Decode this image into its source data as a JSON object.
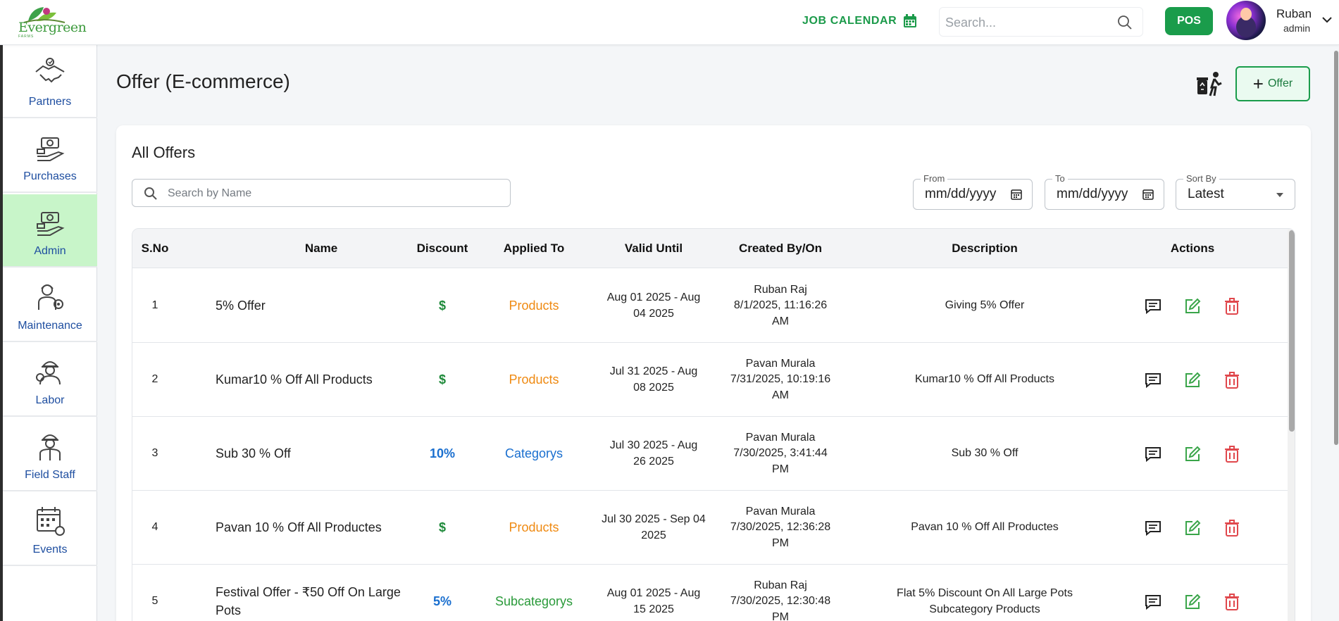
{
  "app": {
    "logo_text": "Evergreen",
    "logo_sub": "FARMS"
  },
  "topbar": {
    "job_calendar_label": "JOB CALENDAR",
    "search_placeholder": "Search...",
    "pos_label": "POS",
    "user_name": "Ruban",
    "user_role": "admin"
  },
  "sidebar": {
    "items": [
      {
        "label": "Partners",
        "icon": "handshake-icon",
        "active": false
      },
      {
        "label": "Purchases",
        "icon": "purchases-icon",
        "active": false
      },
      {
        "label": "Admin",
        "icon": "admin-icon",
        "active": true
      },
      {
        "label": "Maintenance",
        "icon": "maintenance-icon",
        "active": false
      },
      {
        "label": "Labor",
        "icon": "labor-icon",
        "active": false
      },
      {
        "label": "Field Staff",
        "icon": "field-staff-icon",
        "active": false
      },
      {
        "label": "Events",
        "icon": "events-icon",
        "active": false
      }
    ]
  },
  "page": {
    "title": "Offer (E-commerce)",
    "add_button_label": "Offer"
  },
  "card": {
    "title": "All Offers",
    "name_search_placeholder": "Search by Name",
    "from_label": "From",
    "from_value": "mm/dd/yyyy",
    "to_label": "To",
    "to_value": "mm/dd/yyyy",
    "sort_label": "Sort By",
    "sort_value": "Latest"
  },
  "table": {
    "headers": [
      "S.No",
      "Name",
      "Discount",
      "Applied To",
      "Valid Until",
      "Created By/On",
      "Description",
      "Actions"
    ],
    "rows": [
      {
        "sno": "1",
        "name": "5% Offer",
        "discount": "$",
        "applied_to": "Products",
        "valid_line1": "Aug 01 2025 - Aug",
        "valid_line2": "04 2025",
        "created_by": "Ruban Raj",
        "created_on1": "8/1/2025, 11:16:26",
        "created_on2": "AM",
        "description": "Giving 5% Offer",
        "description2": ""
      },
      {
        "sno": "2",
        "name": "Kumar10 % Off All Products",
        "discount": "$",
        "applied_to": "Products",
        "valid_line1": "Jul 31 2025 - Aug",
        "valid_line2": "08 2025",
        "created_by": "Pavan Murala",
        "created_on1": "7/31/2025, 10:19:16",
        "created_on2": "AM",
        "description": "Kumar10 % Off All Products",
        "description2": ""
      },
      {
        "sno": "3",
        "name": "Sub 30 % Off",
        "discount": "10%",
        "applied_to": "Categorys",
        "valid_line1": "Jul 30 2025 - Aug",
        "valid_line2": "26 2025",
        "created_by": "Pavan Murala",
        "created_on1": "7/30/2025, 3:41:44",
        "created_on2": "PM",
        "description": "Sub 30 % Off",
        "description2": ""
      },
      {
        "sno": "4",
        "name": "Pavan 10 % Off All Productes",
        "discount": "$",
        "applied_to": "Products",
        "valid_line1": "Jul 30 2025 - Sep 04",
        "valid_line2": "2025",
        "created_by": "Pavan Murala",
        "created_on1": "7/30/2025, 12:36:28",
        "created_on2": "PM",
        "description": "Pavan 10 % Off All Productes",
        "description2": ""
      },
      {
        "sno": "5",
        "name": "Festival Offer - ₹50 Off On Large Pots",
        "discount": "5%",
        "applied_to": "Subcategorys",
        "valid_line1": "Aug 01 2025 - Aug",
        "valid_line2": "15 2025",
        "created_by": "Ruban Raj",
        "created_on1": "7/30/2025, 12:30:48",
        "created_on2": "PM",
        "description": "Flat 5% Discount On All Large Pots",
        "description2": "Subcategory Products"
      }
    ]
  },
  "colors": {
    "brand_green": "#1a9c4b",
    "active_sidebar": "#c8f5c9",
    "discount_dollar": "#1e8a3a",
    "discount_percent": "#1a6fcf",
    "applied_products": "#ef8a12",
    "applied_categorys": "#1a6fcf",
    "applied_subcategorys": "#2a9a3a",
    "delete_red": "#e0474c"
  }
}
